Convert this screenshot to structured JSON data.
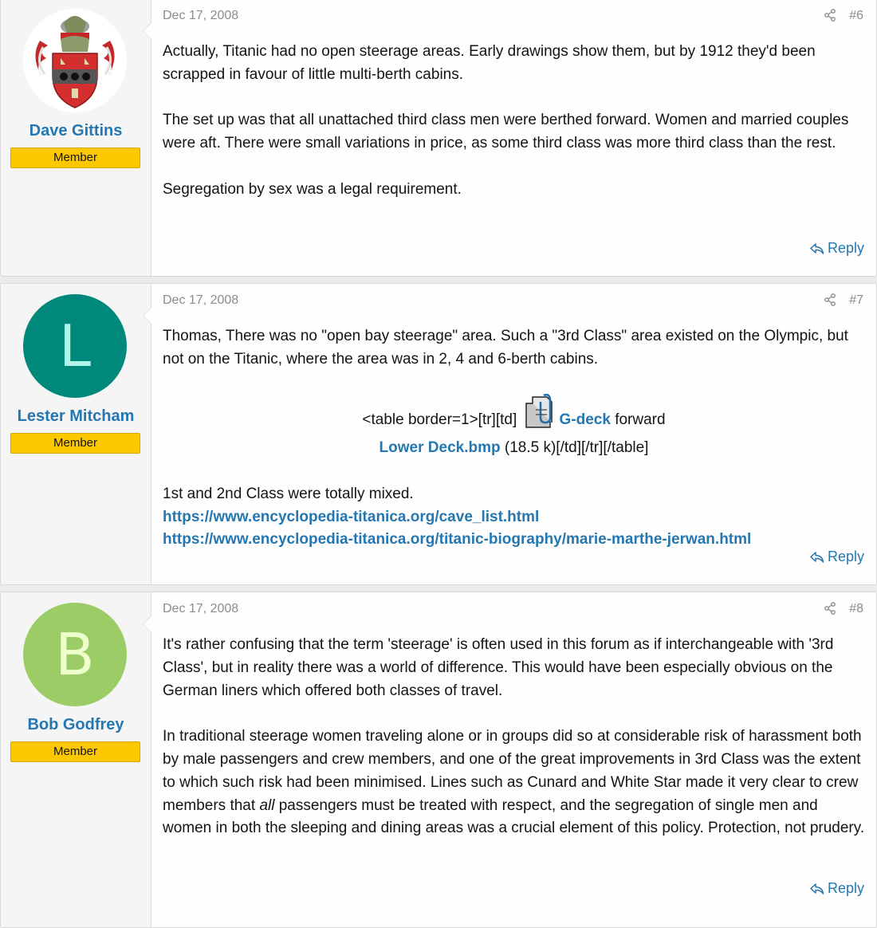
{
  "posts": [
    {
      "author": "Dave Gittins",
      "role": "Member",
      "date": "Dec 17, 2008",
      "number": "#6",
      "avatar": {
        "type": "image",
        "icon": "coat-of-arms-icon"
      },
      "paragraphs": [
        "Actually, Titanic had no open steerage areas. Early drawings show them, but by 1912 they'd been scrapped in favour of little multi-berth cabins.",
        "The set up was that all unattached third class men were berthed forward. Women and married couples were aft. There were small variations in price, as some third class was more third class than the rest.",
        "Segregation by sex was a legal requirement."
      ],
      "reply_label": "Reply"
    },
    {
      "author": "Lester Mitcham",
      "role": "Member",
      "date": "Dec 17, 2008",
      "number": "#7",
      "avatar": {
        "type": "letter",
        "letter": "L",
        "bg": "#00897b",
        "fg": "#b2f5e8"
      },
      "paragraphs": [
        "Thomas, There was no \"open bay steerage\" area. Such a \"3rd Class\" area existed on the Olympic, but not on the Titanic, where the area was in 2, 4 and 6-berth cabins.",
        "1st and 2nd Class were totally mixed."
      ],
      "attachment": {
        "prefix": "<table border=1>[tr][td]",
        "link1": "G-deck",
        "mid": " forward",
        "link2": "Lower Deck.bmp",
        "suffix": " (18.5 k)[/td][/tr][/table]",
        "icon": "attachment-paperclip-icon"
      },
      "links": [
        "https://www.encyclopedia-titanica.org/cave_list.html",
        "https://www.encyclopedia-titanica.org/titanic-biography/marie-marthe-jerwan.html"
      ],
      "reply_label": "Reply"
    },
    {
      "author": "Bob Godfrey",
      "role": "Member",
      "date": "Dec 17, 2008",
      "number": "#8",
      "avatar": {
        "type": "letter",
        "letter": "B",
        "bg": "#9ccc65",
        "fg": "#eeffcc"
      },
      "paragraphs": [
        "It's rather confusing that the term 'steerage' is often used in this forum as if interchangeable with '3rd Class', but in reality there was a world of difference. This would have been especially obvious on the German liners which offered both classes of travel."
      ],
      "p2_before": "In traditional steerage women traveling alone or in groups did so at considerable risk of harassment both by male passengers and crew members, and one of the great improvements in 3rd Class was the extent to which such risk had been minimised. Lines such as Cunard and White Star made it very clear to crew members that ",
      "p2_em": "all",
      "p2_after": " passengers must be treated with respect, and the segregation of single men and women in both the sleeping and dining areas was a crucial element of this policy. Protection, not prudery.",
      "reply_label": "Reply"
    }
  ],
  "colors": {
    "link": "#2577b1",
    "badge": "#fdc800",
    "muted": "#8c8c8c"
  }
}
